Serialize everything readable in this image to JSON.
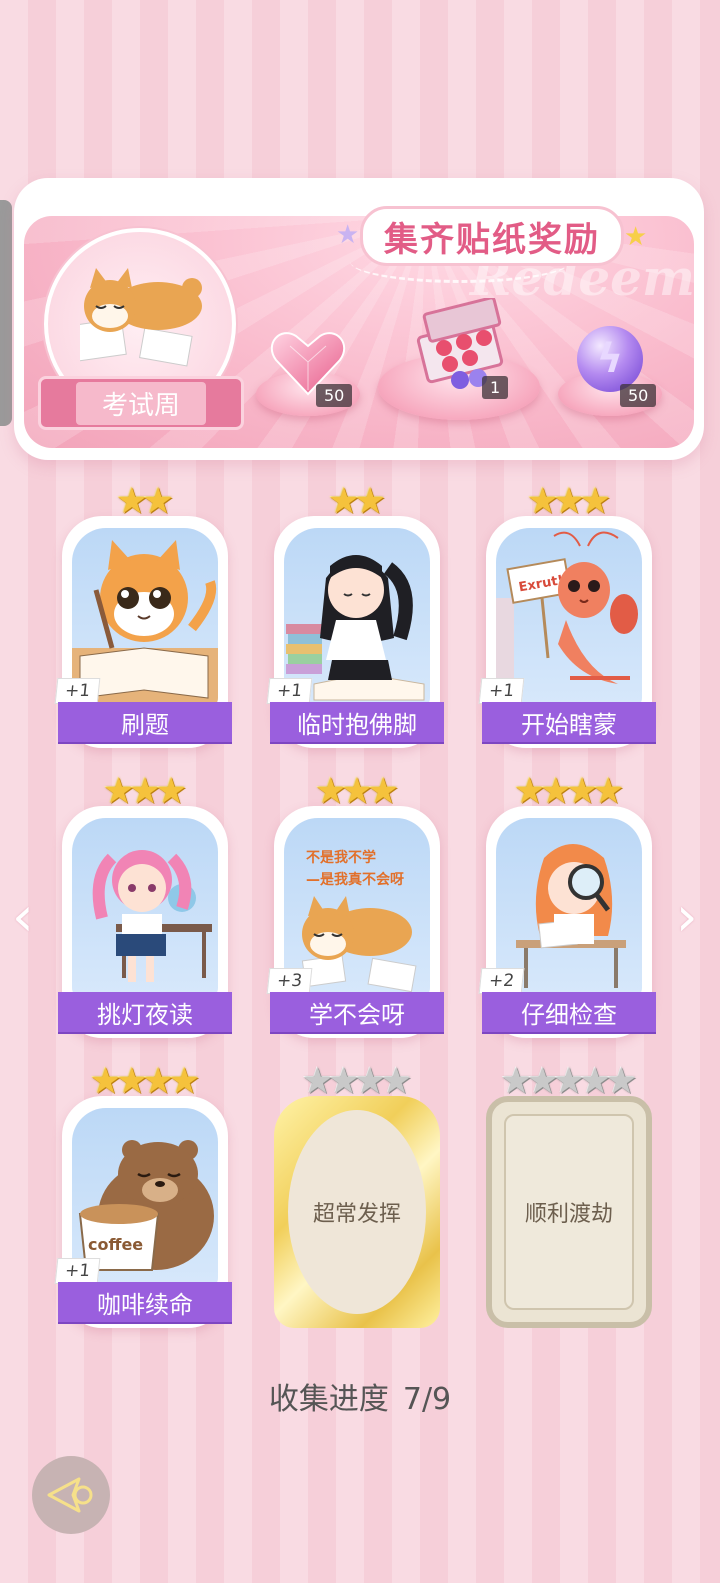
{
  "reward": {
    "title": "集齐贴纸奖励",
    "watermark": "Redeem",
    "event_label": "考试周",
    "items": [
      {
        "icon": "heart-gem-icon",
        "count": "50"
      },
      {
        "icon": "gift-box-icon",
        "count": "1"
      },
      {
        "icon": "energy-orb-icon",
        "count": "50"
      }
    ]
  },
  "stickers": [
    {
      "name": "刷题",
      "stars": 2,
      "max_stars": 2,
      "collected": true,
      "bonus": "+1"
    },
    {
      "name": "临时抱佛脚",
      "stars": 2,
      "max_stars": 2,
      "collected": true,
      "bonus": "+1"
    },
    {
      "name": "开始瞎蒙",
      "stars": 3,
      "max_stars": 3,
      "collected": true,
      "bonus": "+1",
      "sign_text": "Exrut!"
    },
    {
      "name": "挑灯夜读",
      "stars": 3,
      "max_stars": 3,
      "collected": true,
      "bonus": ""
    },
    {
      "name": "学不会呀",
      "stars": 3,
      "max_stars": 3,
      "collected": true,
      "bonus": "+3",
      "caption_line1": "不是我不学",
      "caption_line2": "—是我真不会呀"
    },
    {
      "name": "仔细检查",
      "stars": 4,
      "max_stars": 4,
      "collected": true,
      "bonus": "+2"
    },
    {
      "name": "咖啡续命",
      "stars": 4,
      "max_stars": 4,
      "collected": true,
      "bonus": "+1",
      "cup_text": "coffee"
    },
    {
      "name": "超常发挥",
      "stars": 0,
      "max_stars": 4,
      "collected": false,
      "bonus": ""
    },
    {
      "name": "顺利渡劫",
      "stars": 0,
      "max_stars": 5,
      "collected": false,
      "bonus": ""
    }
  ],
  "progress": {
    "label": "收集进度",
    "value": "7/9"
  },
  "colors": {
    "accent_purple": "#9a5fde",
    "title_pink": "#e25c86",
    "star_gold": "#f5c23c"
  }
}
